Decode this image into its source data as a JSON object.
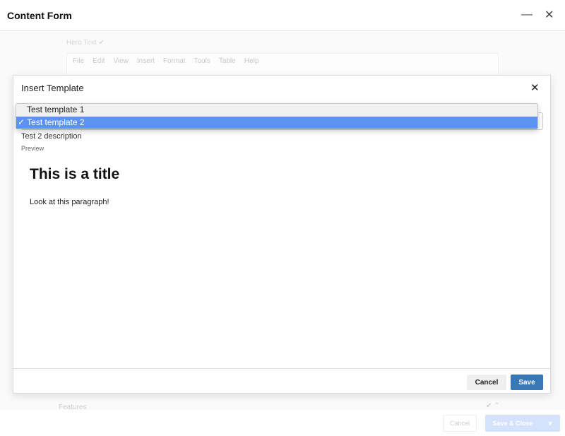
{
  "window": {
    "title": "Content Form",
    "minimize_icon": "minus-icon",
    "close_icon": "close-icon"
  },
  "background": {
    "field_label": "Hero Text ✔",
    "menu": [
      "File",
      "Edit",
      "View",
      "Insert",
      "Format",
      "Tools",
      "Table",
      "Help"
    ],
    "features_label": "Features",
    "features_icons": "✔ ⌃",
    "cancel_label": "Cancel",
    "save_close_label": "Save & Close",
    "dropdown_caret": "▾"
  },
  "modal": {
    "title": "Insert Template",
    "close": "✕",
    "options": [
      "Test template 1",
      "Test template 2"
    ],
    "selected": "✓ Test template 2",
    "description": "Test 2 description",
    "preview_label": "Preview",
    "preview_title": "This is a title",
    "preview_paragraph": "Look at this paragraph!",
    "cancel_label": "Cancel",
    "save_label": "Save"
  },
  "colors": {
    "accent": "#3a78b5",
    "selection": "#5b93ee"
  }
}
